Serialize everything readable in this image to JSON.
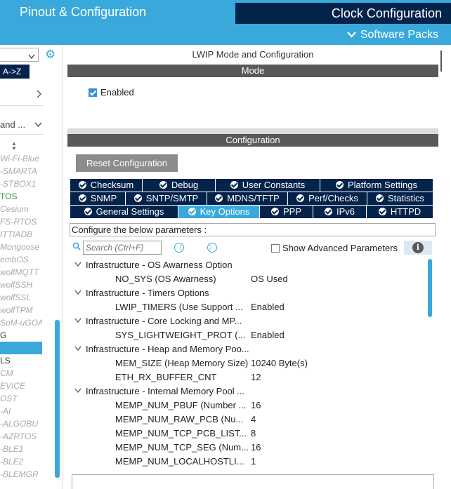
{
  "header": {
    "tab_pinout": "Pinout & Configuration",
    "tab_clock": "Clock Configuration",
    "software_packs": "Software Packs",
    "colors": {
      "primary": "#39a9dc",
      "dark": "#03234b"
    }
  },
  "sidebar": {
    "sort_label": "A->Z",
    "row_a": "and ...",
    "items": [
      {
        "label": "Wi-Fi-Blue",
        "style": "dim"
      },
      {
        "label": "-SMARTA",
        "style": "dim"
      },
      {
        "label": "-STBOX1",
        "style": "dim"
      },
      {
        "label": "TOS",
        "style": "green"
      },
      {
        "label": "Cesium",
        "style": "dim"
      },
      {
        "label": "FS-RTOS",
        "style": "dim"
      },
      {
        "label": "ITTIADB",
        "style": "dim"
      },
      {
        "label": "Mongoose",
        "style": "dim"
      },
      {
        "label": "embOS",
        "style": "dim"
      },
      {
        "label": "wolfMQTT",
        "style": "dim"
      },
      {
        "label": "wolfSSH",
        "style": "dim"
      },
      {
        "label": "wolfSSL",
        "style": "dim"
      },
      {
        "label": "wolfTPM",
        "style": "dim"
      },
      {
        "label": "SoM-uGOA",
        "style": "dim"
      },
      {
        "label": "G",
        "style": "dark"
      },
      {
        "label": "",
        "style": "sel"
      },
      {
        "label": "LS",
        "style": "dark"
      },
      {
        "label": "CM",
        "style": "dim"
      },
      {
        "label": "EVICE",
        "style": "dim"
      },
      {
        "label": "OST",
        "style": "dim"
      },
      {
        "label": "-AI",
        "style": "dim"
      },
      {
        "label": "-ALGOBU",
        "style": "dim"
      },
      {
        "label": "-AZRTOS",
        "style": "dim"
      },
      {
        "label": "-BLE1",
        "style": "dim"
      },
      {
        "label": "-BLE2",
        "style": "dim"
      },
      {
        "label": "-BLEMGR",
        "style": "dim"
      }
    ]
  },
  "main": {
    "title": "LWIP Mode and Configuration",
    "mode_header": "Mode",
    "enabled_label": "Enabled",
    "enabled_checked": true,
    "config_header": "Configuration",
    "reset_button": "Reset Configuration",
    "tab_rows": [
      [
        "Checksum",
        "Debug",
        "User Constants",
        "Platform Settings"
      ],
      [
        "SNMP",
        "SNTP/SMTP",
        "MDNS/TFTP",
        "Perf/Checks",
        "Statistics"
      ],
      [
        "General Settings",
        "Key Options",
        "PPP",
        "IPv6",
        "HTTPD"
      ]
    ],
    "active_tab": "Key Options",
    "configure_label": "Configure the below parameters :",
    "search_placeholder": "Search (Ctrl+F)",
    "show_advanced": "Show Advanced Parameters",
    "show_advanced_checked": false,
    "info_glyph": "i",
    "tree": [
      {
        "type": "group",
        "label": "Infrastructure - OS Awarness Option"
      },
      {
        "type": "param",
        "name": "NO_SYS (OS Awarness)",
        "value": "OS Used"
      },
      {
        "type": "group",
        "label": "Infrastructure - Timers Options"
      },
      {
        "type": "param",
        "name": "LWIP_TIMERS (Use Support ...",
        "value": "Enabled"
      },
      {
        "type": "group",
        "label": "Infrastructure - Core Locking and MP..."
      },
      {
        "type": "param",
        "name": "SYS_LIGHTWEIGHT_PROT (...",
        "value": "Enabled"
      },
      {
        "type": "group",
        "label": "Infrastructure - Heap and Memory Poo..."
      },
      {
        "type": "param",
        "name": "MEM_SIZE (Heap Memory Size)",
        "value": "10240 Byte(s)"
      },
      {
        "type": "param",
        "name": "ETH_RX_BUFFER_CNT",
        "value": "12"
      },
      {
        "type": "group",
        "label": "Infrastructure - Internal Memory Pool ..."
      },
      {
        "type": "param",
        "name": "MEMP_NUM_PBUF (Number ...",
        "value": "16"
      },
      {
        "type": "param",
        "name": "MEMP_NUM_RAW_PCB (Nu...",
        "value": "4"
      },
      {
        "type": "param",
        "name": "MEMP_NUM_TCP_PCB_LIST...",
        "value": "8"
      },
      {
        "type": "param",
        "name": "MEMP_NUM_TCP_SEG (Num...",
        "value": "16"
      },
      {
        "type": "param",
        "name": "MEMP_NUM_LOCALHOSTLI...",
        "value": "1"
      }
    ]
  }
}
